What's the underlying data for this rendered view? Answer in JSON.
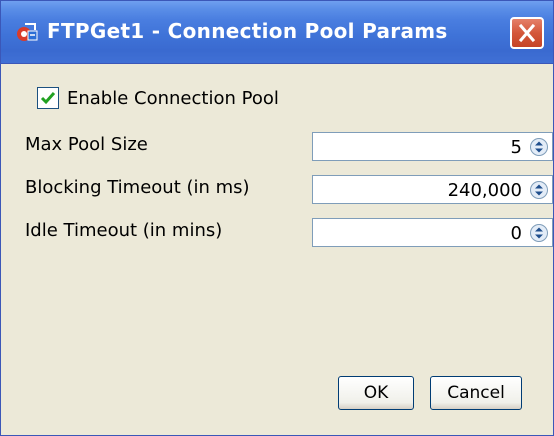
{
  "window": {
    "title": "FTPGet1 - Connection Pool Params",
    "icon": "connection-pool-icon",
    "close_icon": "close-icon"
  },
  "enable_pool": {
    "label": "Enable Connection Pool",
    "checked": true
  },
  "fields": [
    {
      "label": "Max Pool Size",
      "value": "5"
    },
    {
      "label": "Blocking Timeout (in ms)",
      "value": "240,000"
    },
    {
      "label": "Idle Timeout (in mins)",
      "value": "0"
    }
  ],
  "buttons": {
    "ok": "OK",
    "cancel": "Cancel"
  },
  "colors": {
    "titlebar": "#3f73d8",
    "close": "#d4573a",
    "check": "#21a121",
    "dialog_bg": "#ece9d8"
  }
}
